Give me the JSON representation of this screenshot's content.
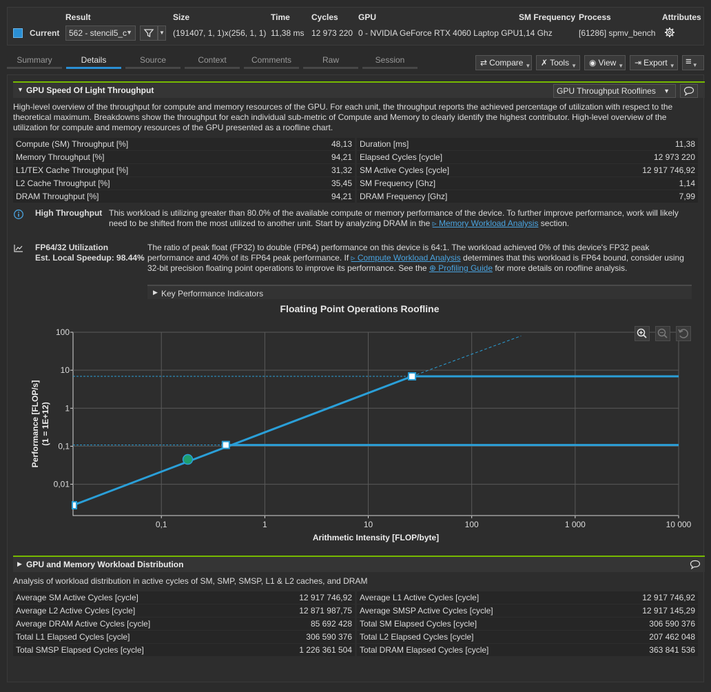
{
  "header": {
    "labels": {
      "result": "Result",
      "size": "Size",
      "time": "Time",
      "cycles": "Cycles",
      "gpu": "GPU",
      "sm_frequency": "SM Frequency",
      "process": "Process",
      "attributes": "Attributes"
    },
    "current_label": "Current",
    "result_value": "562 - stencil5_c",
    "size_value": "(191407, 1, 1)x(256, 1, 1)",
    "time_value": "11,38 ms",
    "cycles_value": "12 973 220",
    "gpu_value": "0 - NVIDIA GeForce RTX 4060 Laptop GPU",
    "sm_frequency_value": "1,14 Ghz",
    "process_value": "[61286] spmv_bench",
    "accent_color": "#2a8fd4"
  },
  "tabs": [
    {
      "label": "Summary",
      "active": false
    },
    {
      "label": "Details",
      "active": true
    },
    {
      "label": "Source",
      "active": false
    },
    {
      "label": "Context",
      "active": false
    },
    {
      "label": "Comments",
      "active": false
    },
    {
      "label": "Raw",
      "active": false
    },
    {
      "label": "Session",
      "active": false
    }
  ],
  "toolbar": {
    "compare": "Compare",
    "tools": "Tools",
    "view": "View",
    "export": "Export"
  },
  "sol": {
    "title": "GPU Speed Of Light Throughput",
    "dropdown": "GPU Throughput Rooflines",
    "description": "High-level overview of the throughput for compute and memory resources of the GPU. For each unit, the throughput reports the achieved percentage of utilization with respect to the theoretical maximum. Breakdowns show the throughput for each individual sub-metric of Compute and Memory to clearly identify the highest contributor. High-level overview of the utilization for compute and memory resources of the GPU presented as a roofline chart.",
    "metrics_left": [
      {
        "name": "Compute (SM) Throughput [%]",
        "value": "48,13"
      },
      {
        "name": "Memory Throughput [%]",
        "value": "94,21"
      },
      {
        "name": "L1/TEX Cache Throughput [%]",
        "value": "31,32"
      },
      {
        "name": "L2 Cache Throughput [%]",
        "value": "35,45"
      },
      {
        "name": "DRAM Throughput [%]",
        "value": "94,21"
      }
    ],
    "metrics_right": [
      {
        "name": "Duration [ms]",
        "value": "11,38"
      },
      {
        "name": "Elapsed Cycles [cycle]",
        "value": "12 973 220"
      },
      {
        "name": "SM Active Cycles [cycle]",
        "value": "12 917 746,92"
      },
      {
        "name": "SM Frequency [Ghz]",
        "value": "1,14"
      },
      {
        "name": "DRAM Frequency [Ghz]",
        "value": "7,99"
      }
    ],
    "rule1": {
      "title": "High Throughput",
      "text_before": "This workload is utilizing greater than 80.0% of the available compute or memory performance of the device. To further improve performance, work will likely need to be shifted from the most utilized to another unit. Start by analyzing DRAM in the ",
      "link": "Memory Workload Analysis",
      "text_after": " section."
    },
    "rule2": {
      "title": "FP64/32 Utilization",
      "speedup": "Est. Local Speedup: 98.44%",
      "text_a": "The ratio of peak float (FP32) to double (FP64) performance on this device is 64:1. The workload achieved 0% of this device's FP32 peak performance and 40% of its FP64 peak performance. If ",
      "link1": "Compute Workload Analysis",
      "text_b": " determines that this workload is FP64 bound, consider using 32-bit precision floating point operations to improve its performance. See the ",
      "link2": "Profiling Guide",
      "text_c": " for more details on roofline analysis."
    },
    "kpi": "Key Performance Indicators"
  },
  "chart_data": {
    "type": "line",
    "title": "Floating Point Operations Roofline",
    "xlabel": "Arithmetic Intensity [FLOP/byte]",
    "ylabel": "Performance [FLOP/s]",
    "ylabel2": "(1 = 1E+12)",
    "x_scale": "log",
    "y_scale": "log",
    "xlim": [
      0.014,
      10000
    ],
    "ylim": [
      0.0015,
      100
    ],
    "x_ticks": [
      0.1,
      1,
      10,
      100,
      1000,
      10000
    ],
    "x_tick_labels": [
      "0,1",
      "1",
      "10",
      "100",
      "1 000",
      "10 000"
    ],
    "y_ticks": [
      0.01,
      0.1,
      1,
      10,
      100
    ],
    "y_tick_labels": [
      "0,01",
      "0,1",
      "1",
      "10",
      "100"
    ],
    "grid": true,
    "bandwidth_roof": {
      "x": [
        0.014,
        26.5
      ],
      "y": [
        0.0028,
        6.9
      ]
    },
    "bandwidth_extension": {
      "x": [
        26.5,
        300
      ],
      "y": [
        6.9,
        80
      ]
    },
    "fp32_roof": {
      "x": [
        26.5,
        10000
      ],
      "y": [
        6.9,
        6.9
      ]
    },
    "fp64_roof": {
      "x": [
        0.42,
        10000
      ],
      "y": [
        0.108,
        0.108
      ]
    },
    "ridge_points": [
      {
        "x": 26.5,
        "y": 6.9
      },
      {
        "x": 0.42,
        "y": 0.108
      }
    ],
    "start_point": {
      "x": 0.014,
      "y": 0.0028
    },
    "achieved": {
      "x": 0.18,
      "y": 0.045
    },
    "colors": {
      "roof": "#2a9fd8",
      "achieved": "#1e9e6e",
      "grid": "#5a5a5a"
    }
  },
  "workload": {
    "title": "GPU and Memory Workload Distribution",
    "description": "Analysis of workload distribution in active cycles of SM, SMP, SMSP, L1 & L2 caches, and DRAM",
    "metrics_left": [
      {
        "name": "Average SM Active Cycles [cycle]",
        "value": "12 917 746,92"
      },
      {
        "name": "Average L2 Active Cycles [cycle]",
        "value": "12 871 987,75"
      },
      {
        "name": "Average DRAM Active Cycles [cycle]",
        "value": "85 692 428"
      },
      {
        "name": "Total L1 Elapsed Cycles [cycle]",
        "value": "306 590 376"
      },
      {
        "name": "Total SMSP Elapsed Cycles [cycle]",
        "value": "1 226 361 504"
      }
    ],
    "metrics_right": [
      {
        "name": "Average L1 Active Cycles [cycle]",
        "value": "12 917 746,92"
      },
      {
        "name": "Average SMSP Active Cycles [cycle]",
        "value": "12 917 145,29"
      },
      {
        "name": "Total SM Elapsed Cycles [cycle]",
        "value": "306 590 376"
      },
      {
        "name": "Total L2 Elapsed Cycles [cycle]",
        "value": "207 462 048"
      },
      {
        "name": "Total DRAM Elapsed Cycles [cycle]",
        "value": "363 841 536"
      }
    ]
  }
}
